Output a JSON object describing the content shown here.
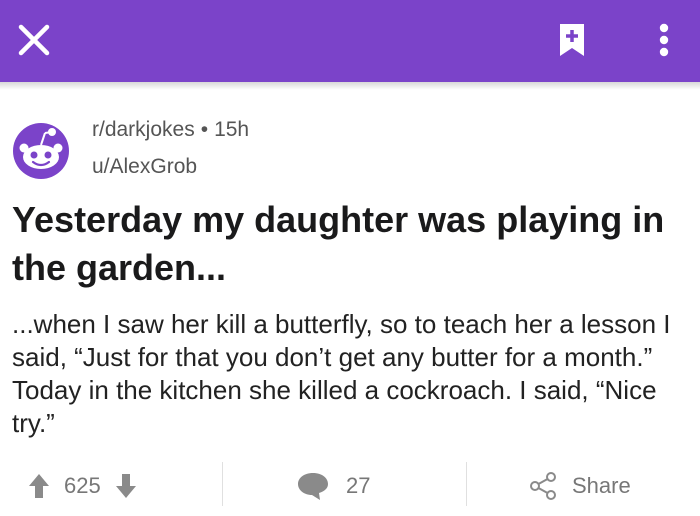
{
  "header": {
    "close_icon": "close-icon",
    "save_icon": "bookmark-plus-icon",
    "more_icon": "more-vertical-icon",
    "background": "#7b43c9"
  },
  "post": {
    "subreddit": "r/darkjokes",
    "separator": "•",
    "age": "15h",
    "author": "u/AlexGrob",
    "title": "Yesterday my daughter was playing in the garden...",
    "body": "...when I saw her kill a butterfly, so to teach her a lesson I said, “Just for that you don’t get any butter for a month.” Today in the kitchen she killed a cockroach. I said, “Nice try.”"
  },
  "actions": {
    "upvote_icon": "upvote-arrow-icon",
    "score": "625",
    "downvote_icon": "downvote-arrow-icon",
    "comment_icon": "comment-bubble-icon",
    "comment_count": "27",
    "share_icon": "share-icon",
    "share_label": "Share"
  }
}
